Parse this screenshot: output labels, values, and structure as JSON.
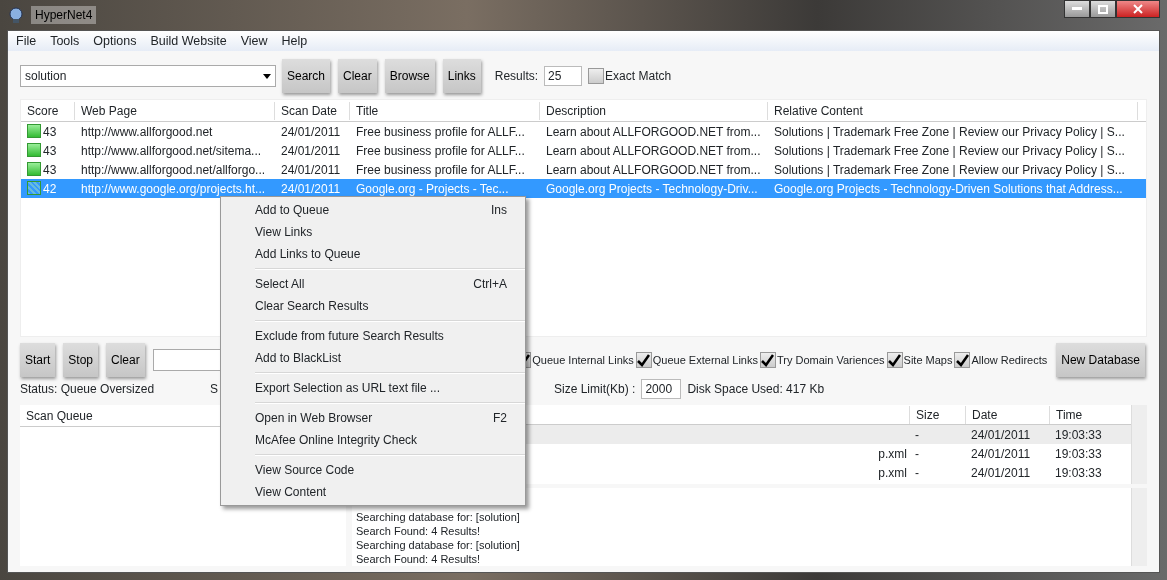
{
  "window": {
    "title": "HyperNet4"
  },
  "menu_bar": [
    "File",
    "Tools",
    "Options",
    "Build Website",
    "View",
    "Help"
  ],
  "search": {
    "value": "solution",
    "buttons": [
      "Search",
      "Clear",
      "Browse",
      "Links"
    ],
    "results_label": "Results:",
    "results_value": "25",
    "exact_match": {
      "label": "Exact Match",
      "checked": false
    }
  },
  "results_table": {
    "columns": [
      "Score",
      "Web Page",
      "Scan Date",
      "Title",
      "Description",
      "Relative Content"
    ],
    "rows": [
      {
        "score": "43",
        "web_page": "http://www.allforgood.net",
        "scan_date": "24/01/2011",
        "title": "Free business profile for ALLF...",
        "description": "Learn about ALLFORGOOD.NET from...",
        "relative_content": "Solutions | Trademark Free Zone | Review our Privacy Policy | S...",
        "selected": false
      },
      {
        "score": "43",
        "web_page": "http://www.allforgood.net/sitema...",
        "scan_date": "24/01/2011",
        "title": "Free business profile for ALLF...",
        "description": "Learn about ALLFORGOOD.NET from...",
        "relative_content": "Solutions | Trademark Free Zone | Review our Privacy Policy | S...",
        "selected": false
      },
      {
        "score": "43",
        "web_page": "http://www.allforgood.net/allforgo...",
        "scan_date": "24/01/2011",
        "title": "Free business profile for ALLF...",
        "description": "Learn about ALLFORGOOD.NET from...",
        "relative_content": "Solutions | Trademark Free Zone | Review our Privacy Policy | S...",
        "selected": false
      },
      {
        "score": "42",
        "web_page": "http://www.google.org/projects.ht...",
        "scan_date": "24/01/2011",
        "title": "Google.org - Projects - Tec...",
        "description": "Google.org Projects - Technology-Driv...",
        "relative_content": "Google.org Projects - Technology-Driven Solutions that Address...",
        "selected": true
      }
    ]
  },
  "crawler": {
    "buttons": [
      "Start",
      "Stop",
      "Clear"
    ],
    "options": [
      {
        "label": "Queue Internal Links",
        "checked": true
      },
      {
        "label": "Queue External Links",
        "checked": true
      },
      {
        "label": "Try Domain Variences",
        "checked": true
      },
      {
        "label": "Site Maps",
        "checked": true
      },
      {
        "label": "Allow Redirects",
        "checked": true
      }
    ],
    "new_database_button": "New Database",
    "status": "Status: Queue Oversized",
    "status_2": "S",
    "size_limit_label": "Size Limit(Kb) :",
    "size_limit_value": "2000",
    "disk_space": "Disk Space Used: 417 Kb"
  },
  "scan_queue": {
    "header": "Scan Queue"
  },
  "files_table": {
    "columns": [
      "Size",
      "Date",
      "Time"
    ],
    "rows": [
      {
        "name": "",
        "size": "-",
        "date": "24/01/2011",
        "time": "19:03:33",
        "selected": true
      },
      {
        "name": "p.xml",
        "size": "-",
        "date": "24/01/2011",
        "time": "19:03:33",
        "selected": false
      },
      {
        "name": "p.xml",
        "size": "-",
        "date": "24/01/2011",
        "time": "19:03:33",
        "selected": false
      }
    ]
  },
  "log": [
    "Searching database for: [solution]",
    "Search Found: 4 Results!",
    "Searching database for: [solution]",
    "Search Found: 4 Results!"
  ],
  "context_menu": [
    [
      {
        "label": "Add to Queue",
        "shortcut": "Ins"
      },
      {
        "label": "View Links"
      },
      {
        "label": "Add Links to Queue"
      }
    ],
    [
      {
        "label": "Select All",
        "shortcut": "Ctrl+A"
      },
      {
        "label": "Clear Search Results"
      }
    ],
    [
      {
        "label": "Exclude from future Search Results"
      },
      {
        "label": "Add to BlackList"
      }
    ],
    [
      {
        "label": "Export Selection as URL text file ..."
      }
    ],
    [
      {
        "label": "Open in Web Browser",
        "shortcut": "F2"
      },
      {
        "label": "McAfee Online Integrity Check"
      }
    ],
    [
      {
        "label": "View Source Code"
      },
      {
        "label": "View Content"
      }
    ]
  ]
}
